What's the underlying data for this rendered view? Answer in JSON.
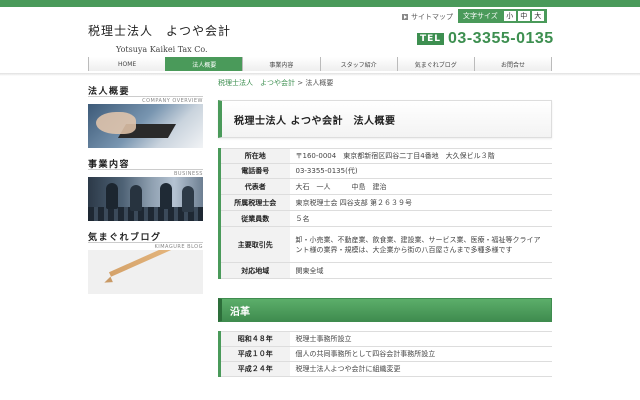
{
  "header": {
    "logo_jp": "税理士法人　よつや会計",
    "logo_en": "Yotsuya Kaikei Tax Co.",
    "sitemap_label": "サイトマップ",
    "fontsize_label": "文字サイズ",
    "fontsize_options": [
      "小",
      "中",
      "大"
    ],
    "tel_badge": "TEL",
    "tel_number": "03-3355-0135"
  },
  "nav": {
    "items": [
      "HOME",
      "法人概要",
      "事業内容",
      "スタッフ紹介",
      "気まぐれブログ",
      "お問合せ"
    ],
    "active_index": 1
  },
  "sidebar": {
    "blocks": [
      {
        "title": "法人概要",
        "subtitle": "COMPANY OVERVIEW"
      },
      {
        "title": "事業内容",
        "subtitle": "BUSINESS"
      },
      {
        "title": "気まぐれブログ",
        "subtitle": "KIMAGURE BLOG"
      }
    ]
  },
  "breadcrumb": {
    "home": "税理士法人　よつや会計",
    "separator": " > ",
    "current": "法人概要"
  },
  "page_title": "税理士法人 よつや会計　法人概要",
  "info_table": [
    {
      "key": "所在地",
      "value": "〒160-0004　東京都新宿区四谷二丁目4番地　大久保ビル３階"
    },
    {
      "key": "電話番号",
      "value": "03-3355-0135(代)"
    },
    {
      "key": "代表者",
      "value": "大石　一人　　　中島　建治"
    },
    {
      "key": "所属税理士会",
      "value": "東京税理士会 四谷支部 第２６３９号"
    },
    {
      "key": "従業員数",
      "value": "５名"
    },
    {
      "key": "主要取引先",
      "value": "卸・小売業、不動産業、飲食業、建設業、サービス業、医療・福祉等クライアント様の業界・規模は、大企業から街の八百屋さんまで多種多様です"
    },
    {
      "key": "対応地域",
      "value": "関東全域"
    }
  ],
  "history_title": "沿革",
  "history": [
    {
      "key": "昭和４８年",
      "value": "税理士事務所設立"
    },
    {
      "key": "平成１０年",
      "value": "個人の共同事務所として四谷会計事務所設立"
    },
    {
      "key": "平成２４年",
      "value": "税理士法人よつや会計に組織変更"
    }
  ],
  "colors": {
    "accent": "#4a9a5a",
    "accent_dark": "#3d8f50"
  },
  "icons": {
    "sitemap": "arrow-right-icon"
  }
}
